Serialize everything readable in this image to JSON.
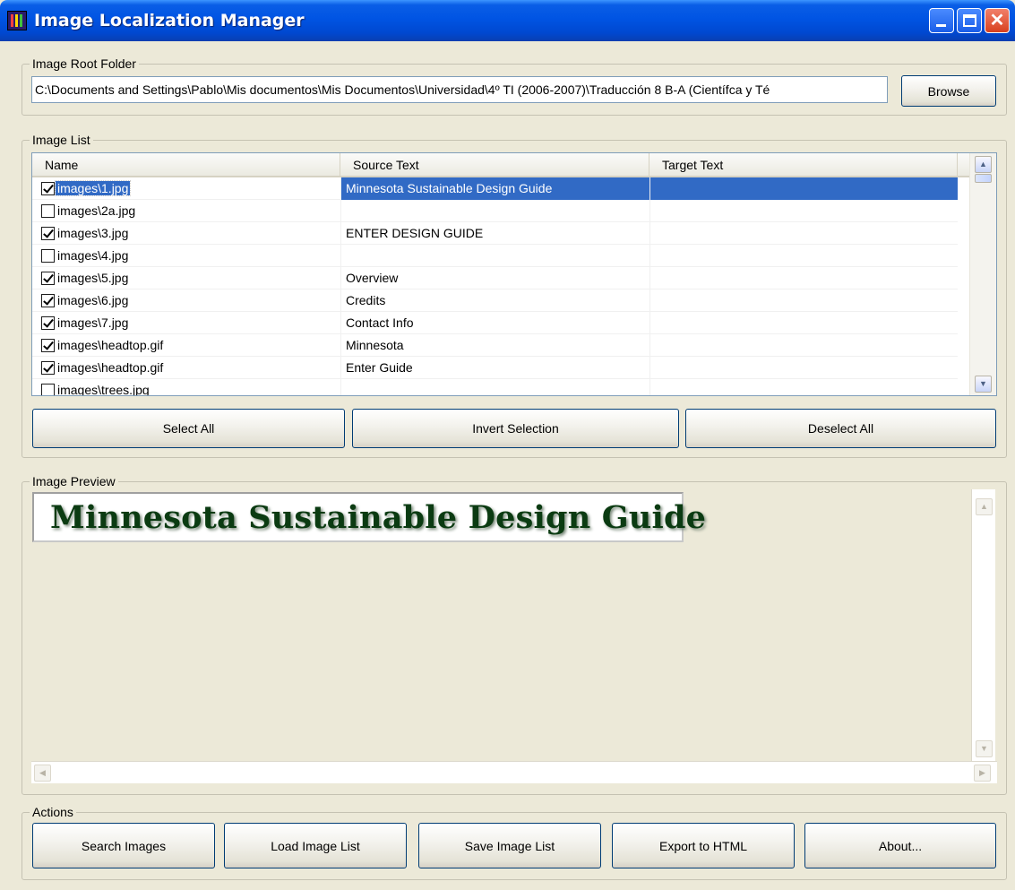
{
  "window": {
    "title": "Image Localization Manager",
    "close_glyph": "✕"
  },
  "root_folder": {
    "group_title": "Image Root Folder",
    "path": "C:\\Documents and Settings\\Pablo\\Mis documentos\\Mis Documentos\\Universidad\\4º TI (2006-2007)\\Traducción 8 B-A (Científca y Té",
    "browse_label": "Browse"
  },
  "image_list": {
    "group_title": "Image List",
    "columns": [
      "Name",
      "Source Text",
      "Target Text"
    ],
    "rows": [
      {
        "checked": true,
        "name": "images\\1.jpg",
        "source": "Minnesota Sustainable Design Guide",
        "target": "",
        "selected": true
      },
      {
        "checked": false,
        "name": "images\\2a.jpg",
        "source": "",
        "target": ""
      },
      {
        "checked": true,
        "name": "images\\3.jpg",
        "source": "ENTER DESIGN GUIDE",
        "target": ""
      },
      {
        "checked": false,
        "name": "images\\4.jpg",
        "source": "",
        "target": ""
      },
      {
        "checked": true,
        "name": "images\\5.jpg",
        "source": "Overview",
        "target": ""
      },
      {
        "checked": true,
        "name": "images\\6.jpg",
        "source": "Credits",
        "target": ""
      },
      {
        "checked": true,
        "name": "images\\7.jpg",
        "source": "Contact Info",
        "target": ""
      },
      {
        "checked": true,
        "name": "images\\headtop.gif",
        "source": "Minnesota",
        "target": ""
      },
      {
        "checked": true,
        "name": "images\\headtop.gif",
        "source": "Enter Guide",
        "target": ""
      },
      {
        "checked": false,
        "name": "images\\trees.jpg",
        "source": "",
        "target": ""
      }
    ],
    "select_all_label": "Select All",
    "invert_selection_label": "Invert Selection",
    "deselect_all_label": "Deselect All"
  },
  "preview": {
    "group_title": "Image Preview",
    "image_text": "Minnesota Sustainable Design Guide"
  },
  "actions": {
    "group_title": "Actions",
    "search_images_label": "Search Images",
    "load_image_list_label": "Load Image List",
    "save_image_list_label": "Save Image List",
    "export_html_label": "Export to HTML",
    "about_label": "About..."
  },
  "icons": {
    "scroll_up": "▲",
    "scroll_down": "▼",
    "scroll_left": "◀",
    "scroll_right": "▶"
  },
  "colors": {
    "titlebar": "#0054e3",
    "selection": "#316ac5",
    "window_bg": "#ece9d8",
    "preview_text": "#0b3b12"
  }
}
